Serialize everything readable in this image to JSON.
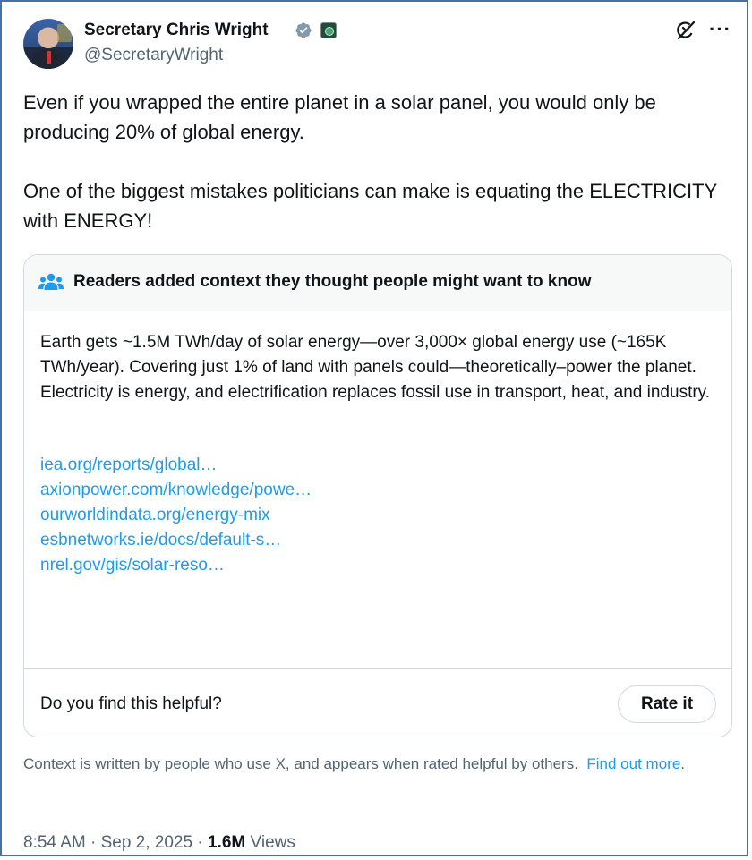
{
  "author": {
    "name": "Secretary Chris Wright",
    "handle": "@SecretaryWright",
    "verified_icon": "verified-badge-icon",
    "affiliation_icon": "doe-seal-icon"
  },
  "header_actions": {
    "grok_icon": "grok-icon",
    "more_label": "···"
  },
  "tweet": {
    "paragraph_1": "Even if you wrapped the entire planet in a solar panel, you would only be producing 20% of global energy.",
    "paragraph_2": "One of the biggest mistakes politicians can make is equating the ELECTRICITY with ENERGY!"
  },
  "community_note": {
    "title": "Readers added context they thought people might want to know",
    "icon": "people-icon",
    "body": "Earth gets ~1.5M TWh/day of solar energy—over 3,000× global energy use (~165K TWh/year). Covering just 1% of land with panels could—theoretically–power the planet. Electricity is energy, and electrification replaces fossil use in transport, heat, and industry.",
    "links": [
      "iea.org/reports/global…",
      "axionpower.com/knowledge/powe…",
      "ourworldindata.org/energy-mix",
      "esbnetworks.ie/docs/default-s…",
      "nrel.gov/gis/solar-reso…"
    ],
    "helpful_question": "Do you find this helpful?",
    "rate_button": "Rate it"
  },
  "disclaimer": {
    "text": "Context is written by people who use X, and appears when rated helpful by others.",
    "link": "Find out more",
    "period": "."
  },
  "meta": {
    "time": "8:54 AM",
    "separator_1": " · ",
    "date": "Sep 2, 2025",
    "separator_2": " · ",
    "views_count": "1.6M",
    "views_label": " Views"
  },
  "colors": {
    "link": "#1d9bf0",
    "secondary_text": "#536471",
    "primary_text": "#0f1419",
    "border": "#cfd9de",
    "verified": "#829aab"
  }
}
